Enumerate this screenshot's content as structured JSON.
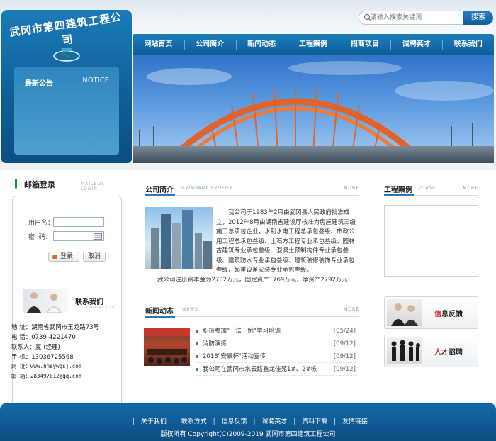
{
  "brand": {
    "company_name": "武冈市第四建筑工程公司"
  },
  "search": {
    "placeholder": "请输入搜索关键词",
    "button_label": "搜索"
  },
  "nav": {
    "items": [
      "网站首页",
      "公司简介",
      "新闻动态",
      "工程案例",
      "招商项目",
      "诚聘英才",
      "联系我们"
    ]
  },
  "notice": {
    "title": "最新公告",
    "title_en": "NOTICE"
  },
  "login": {
    "title": "邮箱登录",
    "title_en": "MAILBOX LOGIN",
    "username_label": "用户名：",
    "password_label": "密  码：",
    "login_button": "登录",
    "cancel_button": "取消"
  },
  "contact": {
    "title": "联系我们",
    "title_en": "CONTACT US",
    "address": "地  址：湖南省武冈市玉龙路73号",
    "phone": "电  话：0739-4221470",
    "person": "联系人：夏 (经理)",
    "mobile": "手  机：13036725568",
    "website": "网  址：www.hnsywgsj.com",
    "email": "邮  箱：283497012@qq.com"
  },
  "about": {
    "title": "公司简介",
    "title_en": "/COMPANY PROFILE",
    "more": "MORE",
    "paragraph1": "我公司于1983年2月由武冈县人民政府批准成立，2012年8月由湖南省建设厅核准为房屋建筑三级施工总承包企业，水利水电工程总承包叁级、市政公用工程总承包叁级、土石方工程专业承包叁级、园林古建筑专业承包叁级、混凝土预制构件专业承包叁级、建筑防水专业承包叁级、建筑装修装饰专业承包叁级、起重设备安装专业承包叁级。",
    "paragraph2": "我公司注册资本金为2732万元，固定资产1769万元，净资产2792万元..."
  },
  "news": {
    "title": "新闻动态",
    "title_en": "/NEWS",
    "more": "MORE",
    "items": [
      {
        "title": "积极参加\"一法一例\"学习培训",
        "date": "[05/24]"
      },
      {
        "title": "消防演练",
        "date": "[09/12]"
      },
      {
        "title": "2018\"安康杯\"活动宣传",
        "date": "[09/12]"
      },
      {
        "title": "我公司在武冈市水云路鑫龙佳苑1#、2#栋",
        "date": "[09/12]"
      }
    ]
  },
  "cases": {
    "title": "工程案例",
    "title_en": "/CASE",
    "more": "MORE"
  },
  "side_links": {
    "feedback_hi": "信",
    "feedback_rest": "息反馈",
    "jobs_hi": "人",
    "jobs_rest": "才招聘"
  },
  "footer": {
    "links": [
      "关于我们",
      "联系方式",
      "信息反馈",
      "诚聘英才",
      "资料下载",
      "友情链接"
    ],
    "copyright": "版权所有 Copyright(C)2009-2019 武冈市第四建筑工程公司"
  },
  "colors": {
    "primary": "#0e5c98",
    "accent_orange": "#e0642a",
    "highlight_red": "#d42828"
  }
}
